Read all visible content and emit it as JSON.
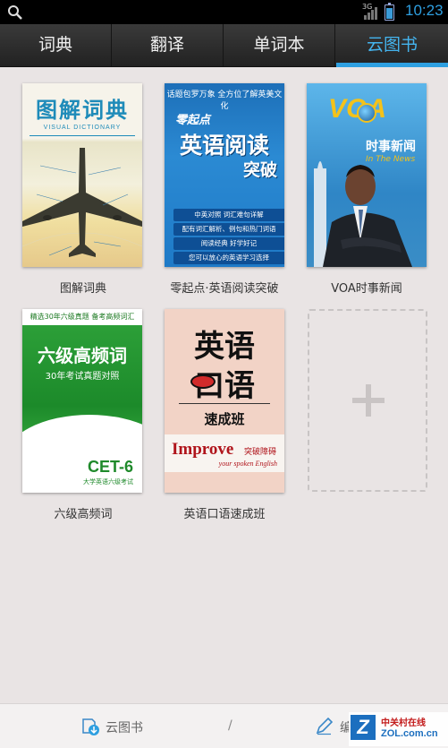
{
  "status_bar": {
    "network": "3G",
    "time": "10:23"
  },
  "tabs": [
    {
      "label": "词典",
      "active": false
    },
    {
      "label": "翻译",
      "active": false
    },
    {
      "label": "单词本",
      "active": false
    },
    {
      "label": "云图书",
      "active": true
    }
  ],
  "accent_color": "#2e9fe0",
  "books": [
    {
      "title": "图解词典",
      "cover": {
        "title": "图解词典",
        "subtitle": "VISUAL DICTIONARY"
      }
    },
    {
      "title": "零起点·英语阅读突破",
      "cover": {
        "top": "话题包罗万象 全方位了解英美文化",
        "pre": "零起点",
        "main": "英语阅读",
        "main2": "突破",
        "rows": [
          "中英对照 词汇难句详解",
          "配有词汇解析、例句和热门词语",
          "阅读经典 好学好记",
          "您可以放心的英语学习选择"
        ]
      }
    },
    {
      "title": "VOA时事新闻",
      "cover": {
        "brand": "VOA",
        "news": "时事新闻",
        "in": "In The News"
      }
    },
    {
      "title": "六级高频词",
      "cover": {
        "top": "精选30年六级真题 备考高频词汇",
        "main": "六级高频词",
        "sub": "30年考试真题对照",
        "level": "CET-6",
        "foot": "大学英语六级考试"
      }
    },
    {
      "title": "英语口语速成班",
      "cover": {
        "line1": "英语",
        "line2": "口语",
        "speed": "速成班",
        "improve": "Improve",
        "improve_cn": "突破障碍",
        "your": "your spoken English"
      }
    }
  ],
  "bottom_bar": {
    "cloud_label": "云图书",
    "separator": "/",
    "edit_label": "编"
  },
  "watermark": {
    "cn": "中关村在线",
    "en": "ZOL.com.cn",
    "letter": "Z"
  }
}
